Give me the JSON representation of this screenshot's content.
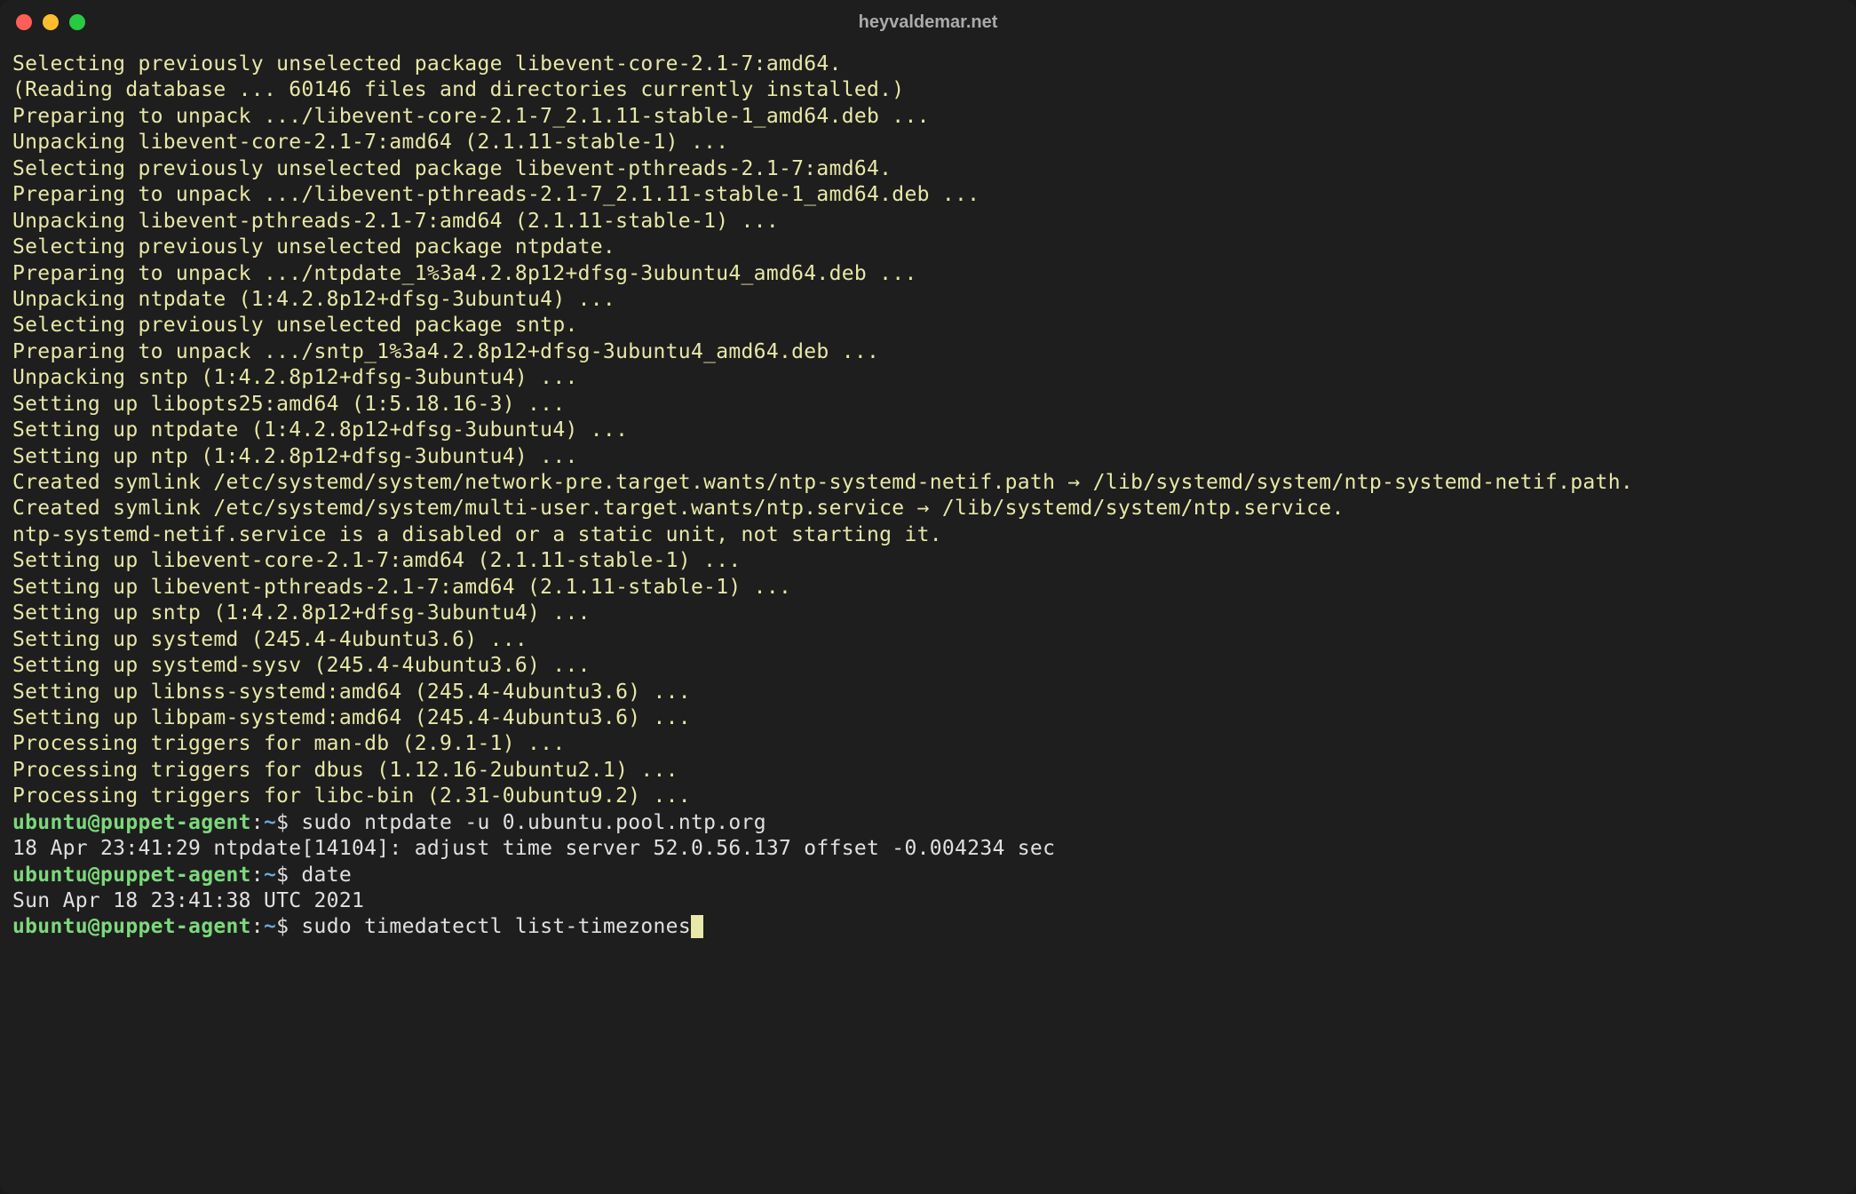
{
  "window": {
    "title": "heyvaldemar.net"
  },
  "colors": {
    "bg": "#1e1e1e",
    "output": "#e8e8a8",
    "prompt_green": "#7cd87c",
    "prompt_blue": "#6aa8d8",
    "white": "#e0e0e0"
  },
  "output_lines": [
    "Selecting previously unselected package libevent-core-2.1-7:amd64.",
    "(Reading database ... 60146 files and directories currently installed.)",
    "Preparing to unpack .../libevent-core-2.1-7_2.1.11-stable-1_amd64.deb ...",
    "Unpacking libevent-core-2.1-7:amd64 (2.1.11-stable-1) ...",
    "Selecting previously unselected package libevent-pthreads-2.1-7:amd64.",
    "Preparing to unpack .../libevent-pthreads-2.1-7_2.1.11-stable-1_amd64.deb ...",
    "Unpacking libevent-pthreads-2.1-7:amd64 (2.1.11-stable-1) ...",
    "Selecting previously unselected package ntpdate.",
    "Preparing to unpack .../ntpdate_1%3a4.2.8p12+dfsg-3ubuntu4_amd64.deb ...",
    "Unpacking ntpdate (1:4.2.8p12+dfsg-3ubuntu4) ...",
    "Selecting previously unselected package sntp.",
    "Preparing to unpack .../sntp_1%3a4.2.8p12+dfsg-3ubuntu4_amd64.deb ...",
    "Unpacking sntp (1:4.2.8p12+dfsg-3ubuntu4) ...",
    "Setting up libopts25:amd64 (1:5.18.16-3) ...",
    "Setting up ntpdate (1:4.2.8p12+dfsg-3ubuntu4) ...",
    "Setting up ntp (1:4.2.8p12+dfsg-3ubuntu4) ...",
    "Created symlink /etc/systemd/system/network-pre.target.wants/ntp-systemd-netif.path → /lib/systemd/system/ntp-systemd-netif.path.",
    "Created symlink /etc/systemd/system/multi-user.target.wants/ntp.service → /lib/systemd/system/ntp.service.",
    "ntp-systemd-netif.service is a disabled or a static unit, not starting it.",
    "Setting up libevent-core-2.1-7:amd64 (2.1.11-stable-1) ...",
    "Setting up libevent-pthreads-2.1-7:amd64 (2.1.11-stable-1) ...",
    "Setting up sntp (1:4.2.8p12+dfsg-3ubuntu4) ...",
    "Setting up systemd (245.4-4ubuntu3.6) ...",
    "Setting up systemd-sysv (245.4-4ubuntu3.6) ...",
    "Setting up libnss-systemd:amd64 (245.4-4ubuntu3.6) ...",
    "Setting up libpam-systemd:amd64 (245.4-4ubuntu3.6) ...",
    "Processing triggers for man-db (2.9.1-1) ...",
    "Processing triggers for dbus (1.12.16-2ubuntu2.1) ...",
    "Processing triggers for libc-bin (2.31-0ubuntu9.2) ..."
  ],
  "prompt1": {
    "userhost": "ubuntu@puppet-agent",
    "separator": ":",
    "path": "~",
    "dollar": "$ ",
    "command": "sudo ntpdate -u 0.ubuntu.pool.ntp.org"
  },
  "ntpdate_output": "18 Apr 23:41:29 ntpdate[14104]: adjust time server 52.0.56.137 offset -0.004234 sec",
  "prompt2": {
    "userhost": "ubuntu@puppet-agent",
    "separator": ":",
    "path": "~",
    "dollar": "$ ",
    "command": "date"
  },
  "date_output": "Sun Apr 18 23:41:38 UTC 2021",
  "prompt3": {
    "userhost": "ubuntu@puppet-agent",
    "separator": ":",
    "path": "~",
    "dollar": "$ ",
    "command": "sudo timedatectl list-timezones"
  }
}
